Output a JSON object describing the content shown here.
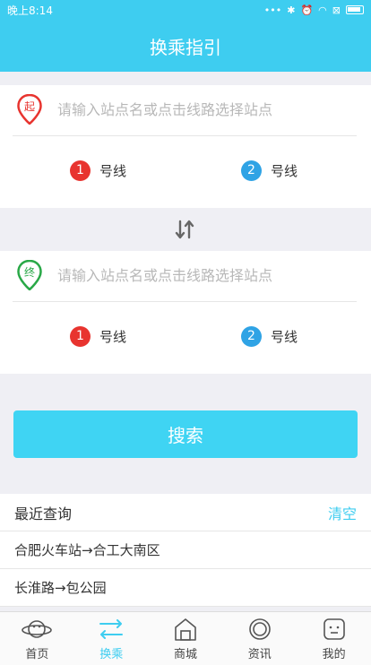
{
  "status_bar": {
    "time": "晚上8:14",
    "icons": [
      "dots-icon",
      "bluetooth-icon",
      "alarm-icon",
      "wifi-icon",
      "sim-icon",
      "battery-icon"
    ]
  },
  "header": {
    "title": "换乘指引"
  },
  "start": {
    "badge": "起",
    "placeholder": "请输入站点名或点击线路选择站点",
    "lines": [
      {
        "num": "1",
        "label": "号线"
      },
      {
        "num": "2",
        "label": "号线"
      }
    ]
  },
  "end": {
    "badge": "终",
    "placeholder": "请输入站点名或点击线路选择站点",
    "lines": [
      {
        "num": "1",
        "label": "号线"
      },
      {
        "num": "2",
        "label": "号线"
      }
    ]
  },
  "search": {
    "label": "搜索"
  },
  "recent": {
    "title": "最近查询",
    "clear": "清空",
    "items": [
      "合肥火车站→合工大南区",
      "长淮路→包公园"
    ]
  },
  "tabs": [
    {
      "label": "首页"
    },
    {
      "label": "换乘"
    },
    {
      "label": "商城"
    },
    {
      "label": "资讯"
    },
    {
      "label": "我的"
    }
  ],
  "colors": {
    "accent": "#3ecdf0",
    "line1": "#e8342f",
    "line2": "#2fa3e5",
    "start_pin": "#e8342f",
    "end_pin": "#29a847"
  }
}
